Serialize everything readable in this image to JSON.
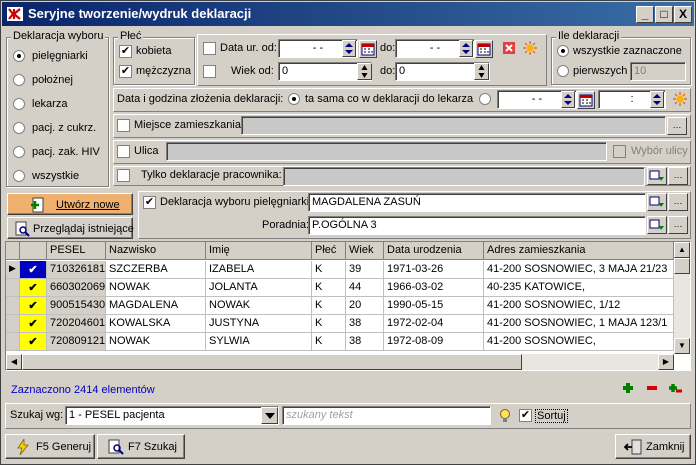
{
  "window": {
    "title": "Seryjne tworzenie/wydruk deklaracji",
    "min": "_",
    "max": "□",
    "close": "X"
  },
  "deklaracja_wyboru": {
    "title": "Deklaracja wyboru",
    "options": [
      "pielęgniarki",
      "położnej",
      "lekarza",
      "pacj. z cukrz.",
      "pacj. zak. HIV",
      "wszystkie"
    ],
    "selected": 0
  },
  "plec": {
    "title": "Płeć",
    "kobieta": "kobieta",
    "mezczyzna": "mężczyzna"
  },
  "data_ur": {
    "label": "Data ur. od:",
    "from": " -  - ",
    "do": "do:",
    "to": " -  - "
  },
  "wiek": {
    "label": "Wiek od:",
    "from": "0",
    "do": "do:",
    "to": "0"
  },
  "ile": {
    "title": "Ile deklaracji",
    "all": "wszystkie zaznaczone",
    "first": "pierwszych",
    "count": "10"
  },
  "data_godzina": {
    "label": "Data i godzina złożenia deklaracji:",
    "same": "ta sama co w deklaracji do lekarza",
    "date": " -  - ",
    "time": " : "
  },
  "miejsce": {
    "label": "Miejsce zamieszkania:",
    "value": ""
  },
  "ulica": {
    "label": "Ulica",
    "value": "",
    "wybor": "Wybór ulicy"
  },
  "tylko": {
    "label": "Tylko deklaracje pracownika:",
    "value": ""
  },
  "buttons": {
    "utworz": "Utwórz nowe",
    "przegladaj": "Przeglądaj istniejące",
    "generuj": "F5 Generuj",
    "szukaj": "F7 Szukaj",
    "zamknij": "Zamknij"
  },
  "deklaracja_piel": {
    "label": "Deklaracja wyboru pielęgniarki:",
    "value": "MAGDALENA ZASUŃ",
    "poradnia_label": "Poradnia:",
    "poradnia": "P.OGÓLNA 3"
  },
  "grid": {
    "headers": [
      "PESEL",
      "Nazwisko",
      "Imię",
      "Płeć",
      "Wiek",
      "Data urodzenia",
      "Adres zamieszkania"
    ],
    "rows": [
      [
        "710326181",
        "SZCZERBA",
        "IZABELA",
        "K",
        "39",
        "1971-03-26",
        "41-200 SOSNOWIEC, 3 MAJA 21/23"
      ],
      [
        "660302069",
        "NOWAK",
        "JOLANTA",
        "K",
        "44",
        "1966-03-02",
        "40-235 KATOWICE,"
      ],
      [
        "900515430",
        "MAGDALENA",
        "NOWAK",
        "K",
        "20",
        "1990-05-15",
        "41-200 SOSNOWIEC, 1/12"
      ],
      [
        "720204601",
        "KOWALSKA",
        "JUSTYNA",
        "K",
        "38",
        "1972-02-04",
        "41-200 SOSNOWIEC, 1 MAJA 123/1"
      ],
      [
        "720809121",
        "NOWAK",
        "SYLWIA",
        "K",
        "38",
        "1972-08-09",
        "41-200 SOSNOWIEC,"
      ]
    ]
  },
  "status": "Zaznaczono 2414 elementów",
  "search": {
    "label": "Szukaj wg:",
    "field": "1 - PESEL pacjenta",
    "placeholder": "szukany tekst",
    "sortuj": "Sortuj"
  },
  "colors": {
    "title_start": "#0a246a",
    "title_end": "#3a6ea5",
    "status_text": "#0000c0",
    "check_yellow": "#ffff00"
  }
}
